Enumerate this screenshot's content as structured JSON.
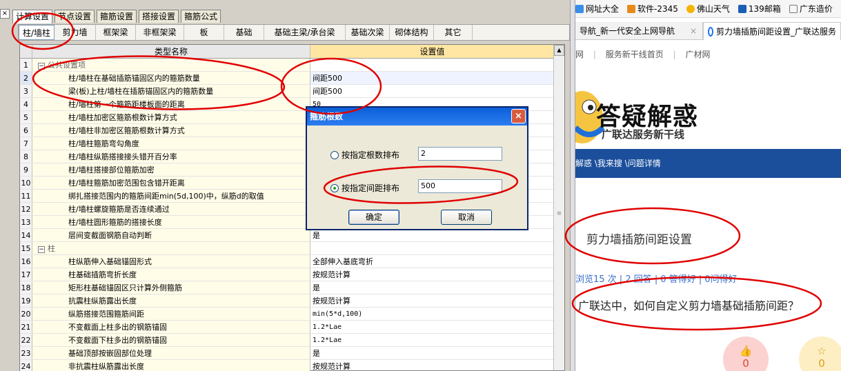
{
  "left_app": {
    "close_glyph": "×",
    "top_tabs": [
      "计算设置",
      "节点设置",
      "箍筋设置",
      "搭接设置",
      "箍筋公式"
    ],
    "sub_tabs": [
      "柱/墙柱",
      "剪力墙",
      "框架梁",
      "非框架梁",
      "板",
      "基础",
      "基础主梁/承台梁",
      "基础次梁",
      "砌体结构",
      "其它"
    ],
    "grid": {
      "col_name": "类型名称",
      "col_value": "设置值",
      "rows": [
        {
          "n": "1",
          "name": "公共设置项",
          "value": "",
          "group": true
        },
        {
          "n": "2",
          "name": "柱/墙柱在基础插筋锚固区内的箍筋数量",
          "value": "间距500"
        },
        {
          "n": "3",
          "name": "梁(板)上柱/墙柱在插筋锚固区内的箍筋数量",
          "value": "间距500"
        },
        {
          "n": "4",
          "name": "柱/墙柱第一个箍筋距楼板面的距离",
          "value": "50"
        },
        {
          "n": "5",
          "name": "柱/墙柱加密区箍筋根数计算方式",
          "value": ""
        },
        {
          "n": "6",
          "name": "柱/墙柱非加密区箍筋根数计算方式",
          "value": ""
        },
        {
          "n": "7",
          "name": "柱/墙柱箍筋弯勾角度",
          "value": ""
        },
        {
          "n": "8",
          "name": "柱/墙柱纵筋搭接接头错开百分率",
          "value": ""
        },
        {
          "n": "9",
          "name": "柱/墙柱搭接部位箍筋加密",
          "value": ""
        },
        {
          "n": "10",
          "name": "柱/墙柱箍筋加密范围包含错开距离",
          "value": ""
        },
        {
          "n": "11",
          "name": "绑扎搭接范围内的箍筋间距min(5d,100)中，纵筋d的取值",
          "value": ""
        },
        {
          "n": "12",
          "name": "柱/墙柱螺旋箍筋是否连续通过",
          "value": ""
        },
        {
          "n": "13",
          "name": "柱/墙柱圆形箍筋的搭接长度",
          "value": ""
        },
        {
          "n": "14",
          "name": "层间变截面钢筋自动判断",
          "value": "是"
        },
        {
          "n": "15",
          "name": "柱",
          "value": "",
          "group": true
        },
        {
          "n": "16",
          "name": "柱纵筋伸入基础锚固形式",
          "value": "全部伸入基底弯折"
        },
        {
          "n": "17",
          "name": "柱基础插筋弯折长度",
          "value": "按规范计算"
        },
        {
          "n": "18",
          "name": "矩形柱基础锚固区只计算外侧箍筋",
          "value": "是"
        },
        {
          "n": "19",
          "name": "抗震柱纵筋露出长度",
          "value": "按规范计算"
        },
        {
          "n": "20",
          "name": "纵筋搭接范围箍筋间距",
          "value": "min(5*d,100)"
        },
        {
          "n": "21",
          "name": "不变截面上柱多出的钢筋锚固",
          "value": "1.2*Lae"
        },
        {
          "n": "22",
          "name": "不变截面下柱多出的钢筋锚固",
          "value": "1.2*Lae"
        },
        {
          "n": "23",
          "name": "基础顶部按嵌固部位处理",
          "value": "是"
        },
        {
          "n": "24",
          "name": "非抗震柱纵筋露出长度",
          "value": "按规范计算"
        }
      ]
    },
    "dialog": {
      "title": "箍筋根数",
      "close_glyph": "×",
      "option1_label": "按指定根数排布",
      "option1_value": "2",
      "option2_label": "按指定间距排布",
      "option2_value": "500",
      "ok_label": "确定",
      "cancel_label": "取消"
    }
  },
  "browser": {
    "bookmarks": [
      "网址大全",
      "软件-2345",
      "佛山天气",
      "139邮箱",
      "广东造价"
    ],
    "tab1_title": "导航_新一代安全上网导航",
    "tab2_title": "剪力墙插筋间距设置_广联达服务",
    "tab_close_glyph": "×",
    "site_nav": [
      "网",
      "服务新干线首页",
      "广材网"
    ],
    "banner_title": "答疑解惑",
    "banner_subtitle": "广联达服务新干线",
    "breadcrumb": "解惑 \\我来搜 \\问题详情",
    "question_title": "剪力墙插筋间距设置",
    "question_stats": "浏览15 次 | 2 回答 | 0 答得好 | 0问得好",
    "question_text": "广联达中，如何自定义剪力墙基础插筋间距？",
    "vote_up": "0",
    "vote_fav": "0"
  },
  "colors": {
    "annotation_red": "#e00000",
    "blue_bar": "#1b4f9c",
    "value_header": "#ffe6a3"
  }
}
